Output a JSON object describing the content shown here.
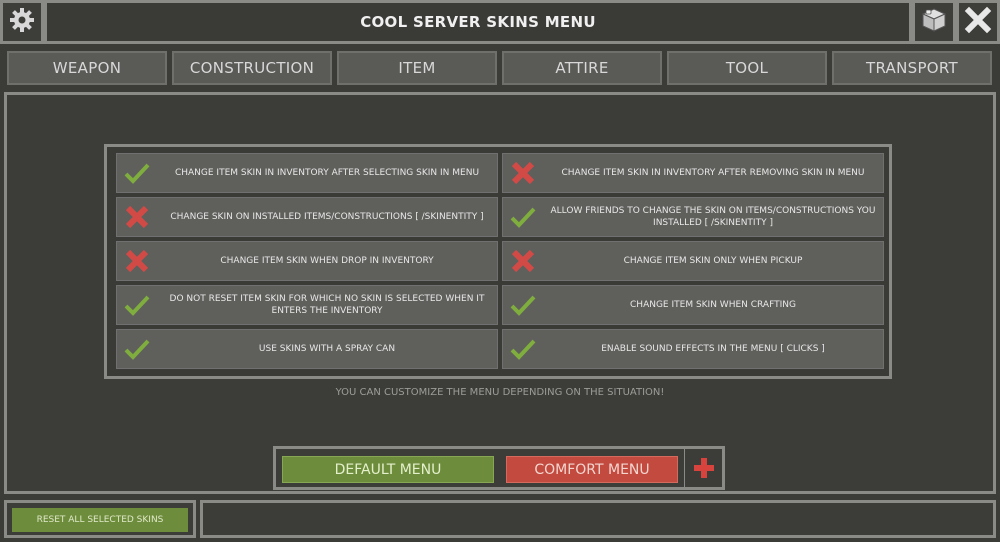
{
  "header": {
    "title": "COOL SERVER SKINS MENU",
    "settings_icon": "gear-icon",
    "cube_icon": "cube-icon",
    "close_icon": "close-icon"
  },
  "tabs": [
    {
      "label": "WEAPON"
    },
    {
      "label": "CONSTRUCTION"
    },
    {
      "label": "ITEM"
    },
    {
      "label": "ATTIRE"
    },
    {
      "label": "TOOL"
    },
    {
      "label": "TRANSPORT"
    }
  ],
  "options": [
    {
      "label": "CHANGE ITEM SKIN IN INVENTORY AFTER SELECTING SKIN IN MENU",
      "enabled": true
    },
    {
      "label": "CHANGE ITEM SKIN IN INVENTORY AFTER REMOVING SKIN IN MENU",
      "enabled": false
    },
    {
      "label": "CHANGE SKIN ON INSTALLED ITEMS/CONSTRUCTIONS   [ /SKINENTITY ]",
      "enabled": false
    },
    {
      "label": "ALLOW FRIENDS TO CHANGE THE SKIN ON ITEMS/CONSTRUCTIONS YOU INSTALLED   [ /SKINENTITY ]",
      "enabled": true
    },
    {
      "label": "CHANGE ITEM SKIN WHEN DROP IN INVENTORY",
      "enabled": false
    },
    {
      "label": "CHANGE ITEM SKIN ONLY WHEN PICKUP",
      "enabled": false
    },
    {
      "label": "DO NOT RESET ITEM SKIN FOR WHICH NO SKIN IS SELECTED WHEN IT ENTERS THE INVENTORY",
      "enabled": true
    },
    {
      "label": "CHANGE ITEM SKIN WHEN CRAFTING",
      "enabled": true
    },
    {
      "label": "USE SKINS WITH A SPRAY CAN",
      "enabled": true
    },
    {
      "label": "ENABLE SOUND EFFECTS IN THE MENU   [ CLICKS ]",
      "enabled": true
    }
  ],
  "hint": "YOU CAN CUSTOMIZE THE MENU DEPENDING ON THE SITUATION!",
  "menu_buttons": {
    "default_label": "DEFAULT MENU",
    "comfort_label": "COMFORT MENU",
    "add_icon": "plus-icon"
  },
  "footer": {
    "reset_label": "RESET ALL SELECTED SKINS"
  },
  "colors": {
    "check": "#7fae3e",
    "cross": "#d24a46",
    "default_btn": "#6d8c3c",
    "comfort_btn": "#c24a3e"
  }
}
